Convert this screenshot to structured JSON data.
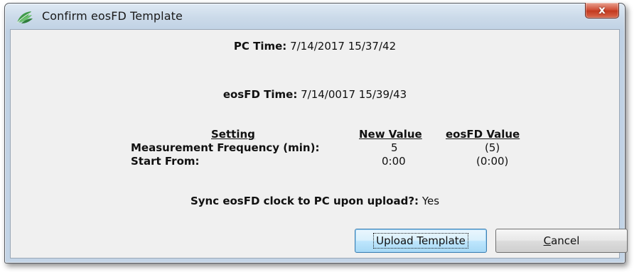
{
  "window": {
    "title": "Confirm eosFD Template",
    "close_glyph": "x",
    "app_icon": "leaf-logo-icon"
  },
  "pc_time": {
    "label": "PC Time:",
    "value": "7/14/2017  15/37/42"
  },
  "eosfd_time": {
    "label": "eosFD Time:",
    "value": "7/14/0017  15/39/43"
  },
  "settings_table": {
    "headers": {
      "setting": "Setting",
      "new_value": "New Value",
      "eosfd_value": "eosFD Value"
    },
    "rows": [
      {
        "setting": "Measurement Frequency (min):",
        "new_value": "5",
        "eosfd_value": "(5)"
      },
      {
        "setting": "Start From:",
        "new_value": "0:00",
        "eosfd_value": "(0:00)"
      }
    ]
  },
  "sync": {
    "label": "Sync eosFD clock to PC upon upload?:",
    "value": "Yes"
  },
  "buttons": {
    "upload": "Upload Template",
    "cancel_first": "C",
    "cancel_rest": "ancel"
  },
  "colors": {
    "titlebar": "#c8d8ea",
    "close_button": "#c83c22",
    "dialog_bg": "#f0f0f0",
    "default_button_border": "#3c7fb1"
  }
}
